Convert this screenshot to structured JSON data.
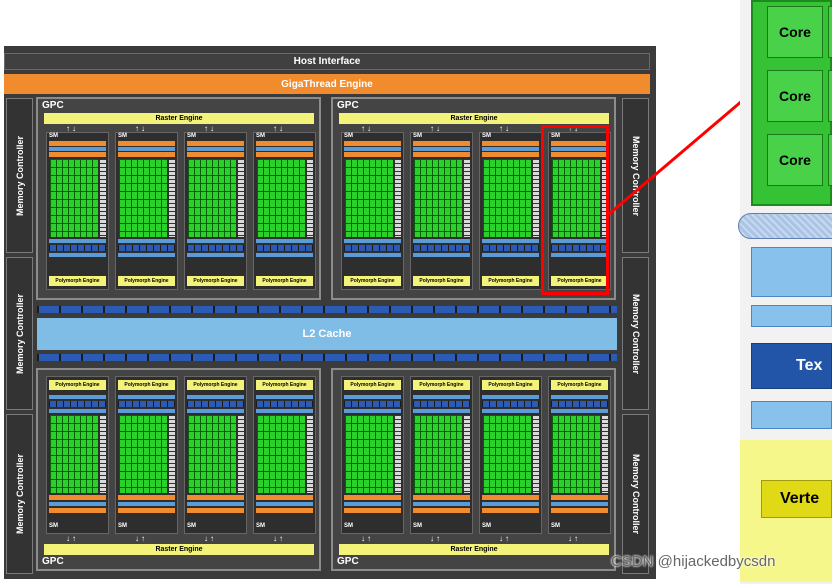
{
  "host_interface": "Host Interface",
  "gigathread_engine": "GigaThread Engine",
  "memory_controller": "Memory Controller",
  "l2_cache": "L2 Cache",
  "gpc_label": "GPC",
  "raster_engine": "Raster Engine",
  "sm_label": "SM",
  "polymorph_engine": "Polymorph Engine",
  "zoom": {
    "core_label": "Core",
    "tex_label": "Tex",
    "vertex_label": "Verte"
  },
  "watermark": "CSDN @hijackedbycsdn",
  "colors": {
    "chip_background": "#3b3b3b",
    "gigathread": "#f08c2e",
    "cuda_core_green": "#2bd12b",
    "raster_polymorph_yellow": "#f3f37a",
    "l2_cache_blue": "#7fbde6",
    "highlight_red": "#ff0000"
  }
}
